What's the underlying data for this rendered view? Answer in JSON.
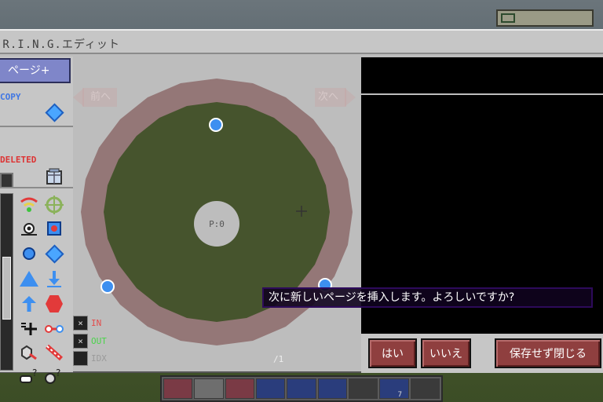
{
  "window": {
    "title": ".R.I.N.G.エディット"
  },
  "toolbox": {
    "page_add_label": "ページ+",
    "copy_label": "COPY",
    "deleted_label": "DELETED"
  },
  "canvas": {
    "prev_label": "前へ",
    "next_label": "次へ",
    "center_label": "P:0",
    "page_count": "/1"
  },
  "io": {
    "in_label": "IN",
    "out_label": "OUT",
    "idx_label": "IDX",
    "check_glyph": "×"
  },
  "dialog": {
    "message": "次に新しいページを挿入します。よろしいですか?",
    "yes_label": "はい",
    "no_label": "いいえ",
    "close_label": "保存せず閉じる"
  },
  "hotbar": {
    "selected_count": "7"
  },
  "colors": {
    "ring": "#8d6b6b",
    "node": "#3d8ff0",
    "button": "#8f3f3f",
    "dialog_bg": "#10031e"
  }
}
